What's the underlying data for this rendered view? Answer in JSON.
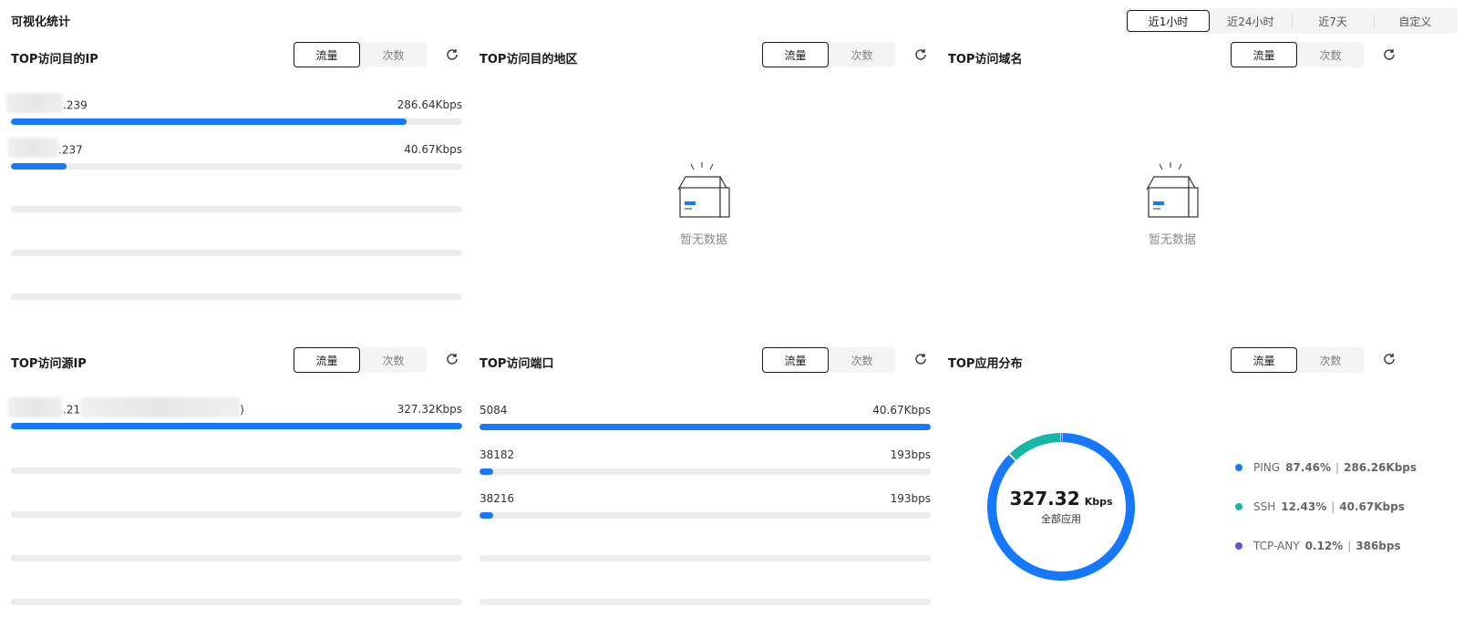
{
  "page_title": "可视化统计",
  "time_ranges": [
    "近1小时",
    "近24小时",
    "近7天",
    "自定义"
  ],
  "active_range": 0,
  "toggle": {
    "traffic": "流量",
    "count": "次数"
  },
  "panels": {
    "dest_ip": {
      "title": "TOP访问目的IP",
      "rows": [
        {
          "label": ".239",
          "value": "286.64Kbps",
          "percent": 87.6
        },
        {
          "label": ".237",
          "value": "40.67Kbps",
          "percent": 12.4
        }
      ]
    },
    "dest_region": {
      "title": "TOP访问目的地区",
      "empty_text": "暂无数据"
    },
    "domain": {
      "title": "TOP访问域名",
      "empty_text": "暂无数据"
    },
    "src_ip": {
      "title": "TOP访问源IP",
      "rows": [
        {
          "label_pre": ".21",
          "label_post": ")",
          "value": "327.32Kbps",
          "percent": 100
        }
      ]
    },
    "port": {
      "title": "TOP访问端口",
      "rows": [
        {
          "label": "5084",
          "value": "40.67Kbps",
          "percent": 100
        },
        {
          "label": "38182",
          "value": "193bps",
          "percent": 3
        },
        {
          "label": "38216",
          "value": "193bps",
          "percent": 3
        }
      ]
    },
    "app": {
      "title": "TOP应用分布",
      "total_value": "327.32",
      "total_unit": "Kbps",
      "total_label": "全部应用",
      "legend": [
        {
          "name": "PING",
          "percent": "87.46%",
          "value": "286.26Kbps",
          "color": "#1677ff",
          "fraction": 0.8746
        },
        {
          "name": "SSH",
          "percent": "12.43%",
          "value": "40.67Kbps",
          "color": "#17b7a6",
          "fraction": 0.1243
        },
        {
          "name": "TCP-ANY",
          "percent": "0.12%",
          "value": "386bps",
          "color": "#6c4dd8",
          "fraction": 0.0012
        }
      ]
    }
  }
}
